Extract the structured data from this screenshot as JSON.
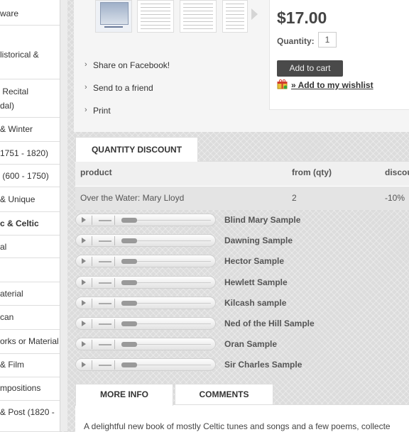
{
  "sidebar": {
    "items": [
      {
        "lines": [
          "ware"
        ],
        "bold": false
      },
      {
        "lines": [
          "listorical &"
        ],
        "bold": false
      },
      {
        "lines": [
          " Recital",
          "dal)"
        ],
        "bold": false
      },
      {
        "lines": [
          "& Winter"
        ],
        "bold": false
      },
      {
        "lines": [
          "1751 - 1820)"
        ],
        "bold": false
      },
      {
        "lines": [
          " (600 - 1750)"
        ],
        "bold": false
      },
      {
        "lines": [
          "& Unique"
        ],
        "bold": false
      },
      {
        "lines": [
          "c & Celtic"
        ],
        "bold": true
      },
      {
        "lines": [
          "al"
        ],
        "bold": false
      },
      {
        "lines": [
          ""
        ],
        "bold": false
      },
      {
        "lines": [
          "aterial"
        ],
        "bold": false
      },
      {
        "lines": [
          "can"
        ],
        "bold": false
      },
      {
        "lines": [
          "orks or Material"
        ],
        "bold": false
      },
      {
        "lines": [
          "& Film"
        ],
        "bold": false
      },
      {
        "lines": [
          "mpositions"
        ],
        "bold": false
      },
      {
        "lines": [
          "& Post (1820 -"
        ],
        "bold": false
      }
    ]
  },
  "product": {
    "thumbnails": [
      "cover",
      "score-page-1",
      "score-page-2",
      "score-page-3"
    ],
    "share_links": [
      "Share on Facebook!",
      "Send to a friend",
      "Print"
    ],
    "price": "$17.00",
    "quantity_label": "Quantity:",
    "quantity_value": "1",
    "add_to_cart": "Add to cart",
    "wishlist": "» Add to my wishlist"
  },
  "quantity_discount": {
    "tab": "QUANTITY DISCOUNT",
    "headers": [
      "product",
      "from (qty)",
      "discou"
    ],
    "rows": [
      {
        "product": "Over the Water: Mary Lloyd",
        "from": "2",
        "discount": "-10%"
      }
    ]
  },
  "samples": [
    "Blind Mary Sample",
    "Dawning Sample",
    "Hector Sample",
    "Hewlett Sample",
    "Kilcash sample",
    "Ned of the Hill Sample",
    "Oran Sample",
    "Sir Charles Sample"
  ],
  "bottom_tabs": [
    "MORE INFO",
    "COMMENTS"
  ],
  "description": "A delightful new book of mostly Celtic tunes and songs and a few poems, collecte",
  "colors": {
    "button_bg": "#4a4a4a",
    "price": "#444444"
  }
}
